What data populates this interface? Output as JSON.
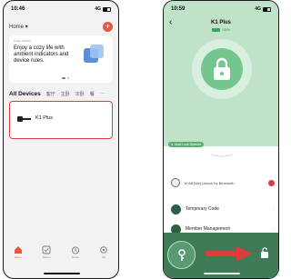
{
  "left_screen": {
    "status_time": "10:46",
    "status_signal": "4G",
    "home_title": "Home",
    "add_icon": "plus-icon",
    "promo": {
      "small_label": "Cozy Home",
      "text": "Enjoy a cozy life with ambient indicators and device rules."
    },
    "tabs": [
      "All Devices",
      "客厅",
      "主卧",
      "次卧",
      "餐",
      "···"
    ],
    "device": {
      "name": "K1 Plus",
      "icon": "lock-icon"
    },
    "tabbar": [
      {
        "label": "Home",
        "icon": "home-icon"
      },
      {
        "label": "Scene",
        "icon": "checkbox-icon"
      },
      {
        "label": "Smart",
        "icon": "clock-icon"
      },
      {
        "label": "Me",
        "icon": "gear-icon"
      }
    ],
    "accent_color": "#e8573c",
    "highlight_color": "#e03a3a"
  },
  "right_screen": {
    "status_time": "10:59",
    "status_signal": "4G",
    "title": "K1 Plus",
    "battery_text": "100%",
    "auto_unlock_label": "Auto Lock Opened",
    "log_entry": "10:58 [Me] Unlock by Bluetooth",
    "menu_items": [
      {
        "label": "Temporary Code",
        "icon": "grid-icon"
      },
      {
        "label": "Member Management",
        "icon": "person-icon"
      }
    ],
    "key_icon": "key-icon",
    "unlock_icon": "unlocked-padlock-icon",
    "theme_color": "#3e7b56",
    "header_color": "#bfe2c9",
    "arrow_color": "#e03a3a"
  }
}
